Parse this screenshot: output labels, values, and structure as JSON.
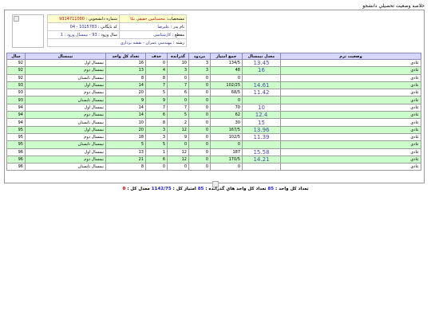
{
  "page_title": "خلاصه وضعيت تحصيلي دانشجو",
  "student": {
    "name_label": "مشخصات:",
    "name_value": "محمدامين حقيقي نكا",
    "id_label": "شماره دانشجويي :",
    "id_value": "9314711000",
    "father_label": "نام پدر :",
    "father_value": "عليرضا",
    "file_label": "كد بايگاني :",
    "file_value": "1015783 - 04",
    "degree_label": "مقطع :",
    "degree_value": "كارشناسي",
    "entry_label": "سال ورود :",
    "entry_value": "93 - نيمسال ورود : 1",
    "major_label": "رشته :",
    "major_value": "مهندسي عمران - نقشه برداري"
  },
  "columns": [
    "وضعيت ترم",
    "معدل نيمسال",
    "جمع امتياز",
    "مردود",
    "گذرانده",
    "حذف",
    "تعداد كل واحد",
    "نيمسال",
    "سال"
  ],
  "rows": [
    {
      "status": "عادي",
      "avg": "13.45",
      "points": "134/5",
      "failed": "3",
      "passed": "10",
      "dropped": "0",
      "units": "16",
      "term": "نيمسال اول",
      "year": "92"
    },
    {
      "status": "عادي",
      "avg": "16",
      "points": "48",
      "failed": "3",
      "passed": "3",
      "dropped": "4",
      "units": "13",
      "term": "نيمسال دوم",
      "year": "92"
    },
    {
      "status": "عادي",
      "avg": "",
      "points": "0",
      "failed": "0",
      "passed": "0",
      "dropped": "8",
      "units": "8",
      "term": "نيمسال تابستان",
      "year": "92"
    },
    {
      "status": "عادي",
      "avg": "14.61",
      "points": "102/25",
      "failed": "0",
      "passed": "7",
      "dropped": "7",
      "units": "14",
      "term": "نيمسال اول",
      "year": "93"
    },
    {
      "status": "عادي",
      "avg": "11.42",
      "points": "68/5",
      "failed": "0",
      "passed": "6",
      "dropped": "5",
      "units": "20",
      "term": "نيمسال دوم",
      "year": "93"
    },
    {
      "status": "عادي",
      "avg": "",
      "points": "0",
      "failed": "0",
      "passed": "0",
      "dropped": "9",
      "units": "9",
      "term": "نيمسال تابستان",
      "year": "93"
    },
    {
      "status": "عادي",
      "avg": "10",
      "points": "70",
      "failed": "0",
      "passed": "7",
      "dropped": "7",
      "units": "14",
      "term": "نيمسال اول",
      "year": "94"
    },
    {
      "status": "عادي",
      "avg": "12.4",
      "points": "62",
      "failed": "0",
      "passed": "5",
      "dropped": "6",
      "units": "14",
      "term": "نيمسال دوم",
      "year": "94"
    },
    {
      "status": "عادي",
      "avg": "15",
      "points": "30",
      "failed": "0",
      "passed": "2",
      "dropped": "8",
      "units": "10",
      "term": "نيمسال تابستان",
      "year": "94"
    },
    {
      "status": "عادي",
      "avg": "13.96",
      "points": "167/5",
      "failed": "0",
      "passed": "12",
      "dropped": "3",
      "units": "20",
      "term": "نيمسال اول",
      "year": "95"
    },
    {
      "status": "عادي",
      "avg": "11.39",
      "points": "102/5",
      "failed": "0",
      "passed": "9",
      "dropped": "3",
      "units": "18",
      "term": "نيمسال دوم",
      "year": "95"
    },
    {
      "status": "عادي",
      "avg": "",
      "points": "0",
      "failed": "0",
      "passed": "0",
      "dropped": "5",
      "units": "5",
      "term": "نيمسال تابستان",
      "year": "95"
    },
    {
      "status": "عادي",
      "avg": "15.58",
      "points": "187",
      "failed": "0",
      "passed": "12",
      "dropped": "1",
      "units": "13",
      "term": "نيمسال اول",
      "year": "96"
    },
    {
      "status": "عادي",
      "avg": "14.21",
      "points": "170/5",
      "failed": "0",
      "passed": "12",
      "dropped": "6",
      "units": "21",
      "term": "نيمسال دوم",
      "year": "96"
    },
    {
      "status": "عادي",
      "avg": "",
      "points": "0",
      "failed": "0",
      "passed": "0",
      "dropped": "0",
      "units": "8",
      "term": "نيمسال تابستان",
      "year": "96"
    }
  ],
  "summary": {
    "total_units_label": "تعداد كل واحد :",
    "total_units": "85",
    "passed_label": "تعداد كل واحد هاي گذرانده :",
    "passed": "85",
    "points_label": "امتياز كل :",
    "points": "1142/75",
    "gpa_label": "معدل كل :",
    "gpa": "0"
  }
}
